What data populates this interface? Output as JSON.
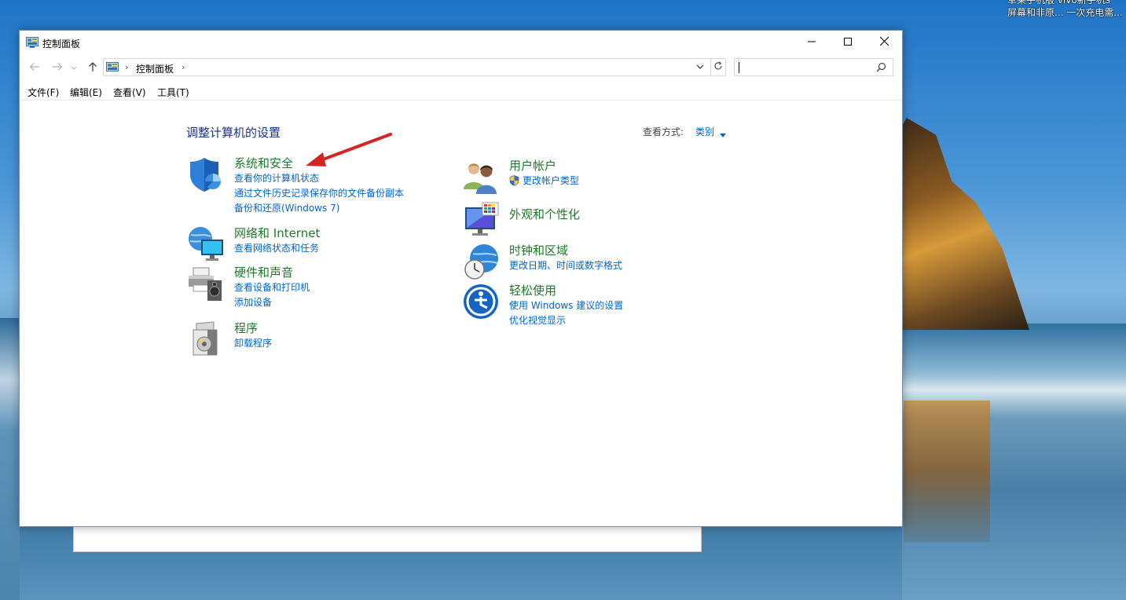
{
  "desktop": {
    "label_line1": "草莱手机版 vivo新手机s",
    "label_line2": "屏幕和非原... 一次充电需..."
  },
  "window": {
    "title": "控制面板",
    "icons": {
      "app": "control-panel-icon",
      "minimize": "minimize-icon",
      "maximize": "maximize-icon",
      "close": "close-icon"
    }
  },
  "nav": {
    "breadcrumb": "控制面板",
    "search_placeholder": "",
    "icons": {
      "back": "back-arrow-icon",
      "forward": "forward-arrow-icon",
      "recent": "chevron-down-icon",
      "up": "up-arrow-icon",
      "refresh": "refresh-icon",
      "search": "search-icon"
    }
  },
  "menu": {
    "items": [
      "文件(F)",
      "编辑(E)",
      "查看(V)",
      "工具(T)"
    ]
  },
  "main": {
    "title": "调整计算机的设置",
    "view_by_label": "查看方式:",
    "view_by_value": "类别",
    "categories": [
      {
        "title": "系统和安全",
        "icon": "shield-icon",
        "links": [
          "查看你的计算机状态",
          "通过文件历史记录保存你的文件备份副本",
          "备份和还原(Windows 7)"
        ]
      },
      {
        "title": "网络和 Internet",
        "icon": "network-globe-icon",
        "links": [
          "查看网络状态和任务"
        ]
      },
      {
        "title": "硬件和声音",
        "icon": "printer-speaker-icon",
        "links": [
          "查看设备和打印机",
          "添加设备"
        ]
      },
      {
        "title": "程序",
        "icon": "programs-disc-icon",
        "links": [
          "卸载程序"
        ]
      },
      {
        "title": "用户帐户",
        "icon": "users-icon",
        "links": [
          "更改帐户类型"
        ]
      },
      {
        "title": "外观和个性化",
        "icon": "monitor-palette-icon",
        "links": []
      },
      {
        "title": "时钟和区域",
        "icon": "clock-globe-icon",
        "links": [
          "更改日期、时间或数字格式"
        ]
      },
      {
        "title": "轻松使用",
        "icon": "ease-of-access-icon",
        "links": [
          "使用 Windows 建议的设置",
          "优化视觉显示"
        ]
      }
    ]
  },
  "colors": {
    "category_title": "#1e7a28",
    "link": "#0066cc",
    "page_title": "#1e3287",
    "annotation_arrow": "#d42424"
  }
}
